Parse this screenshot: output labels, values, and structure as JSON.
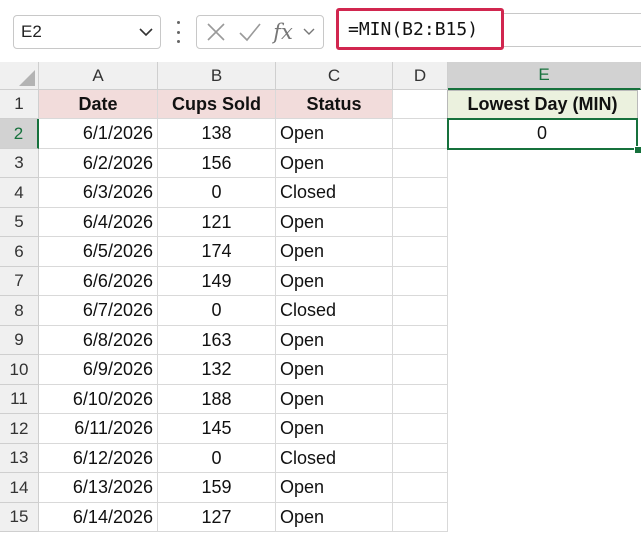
{
  "namebox": {
    "value": "E2"
  },
  "formula_bar": {
    "fx_label": "fx",
    "formula": "=MIN(B2:B15)"
  },
  "columns": [
    "A",
    "B",
    "C",
    "D",
    "E"
  ],
  "selected_column": "E",
  "selected_row": "2",
  "headers": {
    "date": "Date",
    "cups_sold": "Cups Sold",
    "status": "Status",
    "lowest_day": "Lowest Day (MIN)"
  },
  "result": {
    "lowest_value": "0"
  },
  "rows": [
    {
      "row": "2",
      "date": "6/1/2026",
      "cups": "138",
      "status": "Open"
    },
    {
      "row": "3",
      "date": "6/2/2026",
      "cups": "156",
      "status": "Open"
    },
    {
      "row": "4",
      "date": "6/3/2026",
      "cups": "0",
      "status": "Closed"
    },
    {
      "row": "5",
      "date": "6/4/2026",
      "cups": "121",
      "status": "Open"
    },
    {
      "row": "6",
      "date": "6/5/2026",
      "cups": "174",
      "status": "Open"
    },
    {
      "row": "7",
      "date": "6/6/2026",
      "cups": "149",
      "status": "Open"
    },
    {
      "row": "8",
      "date": "6/7/2026",
      "cups": "0",
      "status": "Closed"
    },
    {
      "row": "9",
      "date": "6/8/2026",
      "cups": "163",
      "status": "Open"
    },
    {
      "row": "10",
      "date": "6/9/2026",
      "cups": "132",
      "status": "Open"
    },
    {
      "row": "11",
      "date": "6/10/2026",
      "cups": "188",
      "status": "Open"
    },
    {
      "row": "12",
      "date": "6/11/2026",
      "cups": "145",
      "status": "Open"
    },
    {
      "row": "13",
      "date": "6/12/2026",
      "cups": "0",
      "status": "Closed"
    },
    {
      "row": "14",
      "date": "6/13/2026",
      "cups": "159",
      "status": "Open"
    },
    {
      "row": "15",
      "date": "6/14/2026",
      "cups": "127",
      "status": "Open"
    }
  ],
  "header_row_number": "1",
  "colors": {
    "accent": "#16713c",
    "highlight_border": "#d1264f",
    "header_fill_abc": "#f2dcdb",
    "header_fill_e": "#ebf1de"
  },
  "icons": [
    "chevron-down-icon",
    "more-vert-icon",
    "cancel-icon",
    "enter-check-icon",
    "function-icon"
  ]
}
